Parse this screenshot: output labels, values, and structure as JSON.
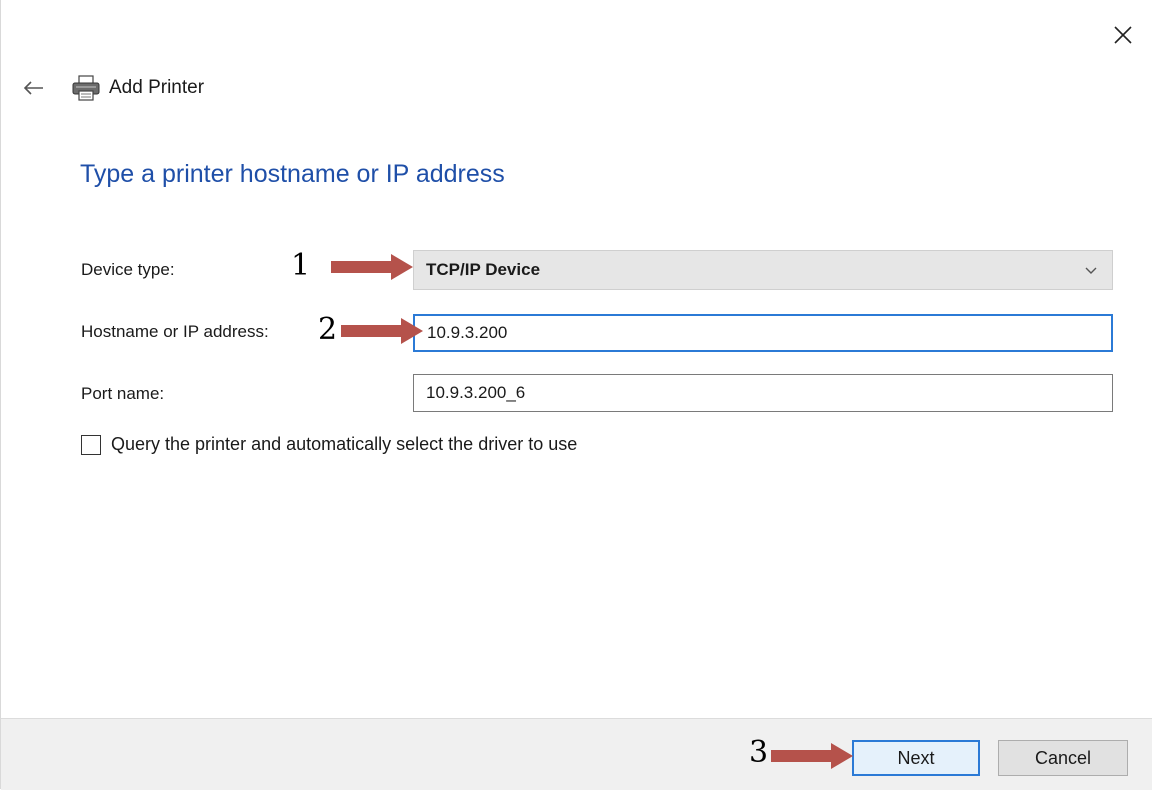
{
  "window": {
    "title": "Add Printer",
    "close_icon": "close-icon",
    "back_icon": "back-arrow-icon",
    "printer_icon": "printer-icon"
  },
  "heading": "Type a printer hostname or IP address",
  "form": {
    "device_type_label": "Device type:",
    "device_type_value": "TCP/IP Device",
    "hostname_label": "Hostname or IP address:",
    "hostname_value": "10.9.3.200",
    "port_label": "Port name:",
    "port_value": "10.9.3.200_6",
    "query_checkbox_label": "Query the printer and automatically select the driver to use",
    "query_checkbox_checked": false
  },
  "footer": {
    "next_label": "Next",
    "cancel_label": "Cancel"
  },
  "annotations": {
    "step1": "1",
    "step2": "2",
    "step3": "3",
    "arrow_color": "#b5524b"
  },
  "colors": {
    "heading": "#1f4fa8",
    "focus_border": "#2b7ad6",
    "footer_bg": "#f0f0f0"
  }
}
